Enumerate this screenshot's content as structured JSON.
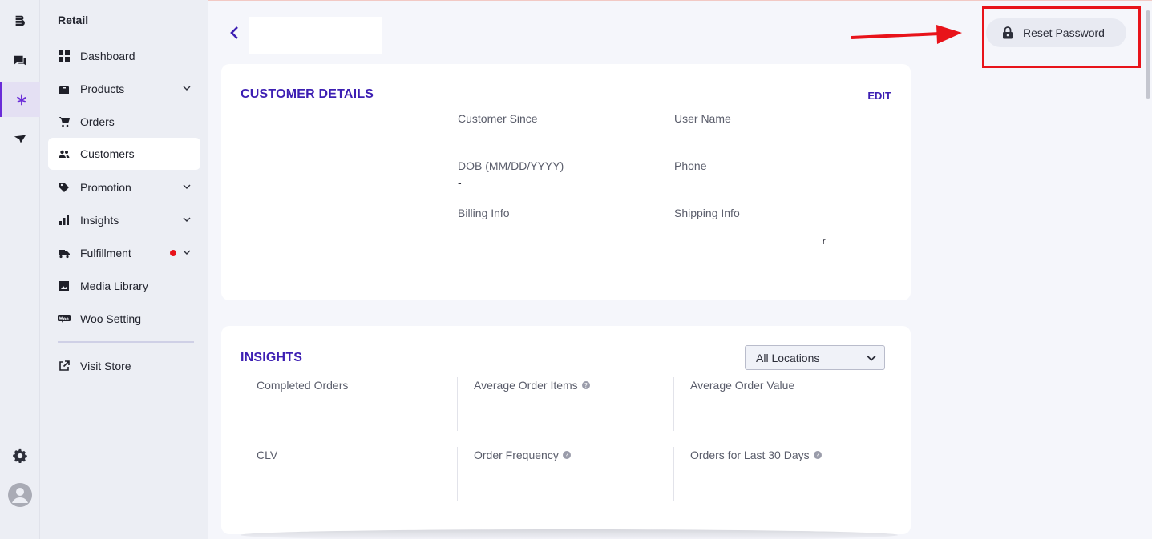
{
  "sidebar": {
    "title": "Retail",
    "items": [
      {
        "label": "Dashboard",
        "icon": "dashboard-icon"
      },
      {
        "label": "Products",
        "icon": "box-icon"
      },
      {
        "label": "Orders",
        "icon": "cart-icon"
      },
      {
        "label": "Customers",
        "icon": "users-icon"
      },
      {
        "label": "Promotion",
        "icon": "tag-icon"
      },
      {
        "label": "Insights",
        "icon": "bar-chart-icon"
      },
      {
        "label": "Fulfillment",
        "icon": "truck-icon"
      },
      {
        "label": "Media Library",
        "icon": "image-icon"
      },
      {
        "label": "Woo Setting",
        "icon": "woo-icon"
      },
      {
        "label": "Visit Store",
        "icon": "external-link-icon"
      }
    ]
  },
  "header": {
    "reset_password_label": "Reset Password"
  },
  "customer_details": {
    "title": "CUSTOMER DETAILS",
    "edit_label": "EDIT",
    "fields": [
      {
        "label": "Customer Since",
        "value": ""
      },
      {
        "label": "User Name",
        "value": ""
      },
      {
        "label": "DOB (MM/DD/YYYY)",
        "value": "-"
      },
      {
        "label": "Phone",
        "value": ""
      },
      {
        "label": "Billing Info",
        "value": ""
      },
      {
        "label": "Shipping Info",
        "value": "r"
      }
    ]
  },
  "insights": {
    "title": "INSIGHTS",
    "location_select": "All Locations",
    "metrics": [
      {
        "label": "Completed Orders"
      },
      {
        "label": "Average Order Items"
      },
      {
        "label": "Average Order Value"
      },
      {
        "label": "CLV"
      },
      {
        "label": "Order Frequency"
      },
      {
        "label": "Orders for Last 30 Days"
      }
    ]
  },
  "colors": {
    "accent": "#3d1fb3",
    "highlight": "#e8131a"
  }
}
